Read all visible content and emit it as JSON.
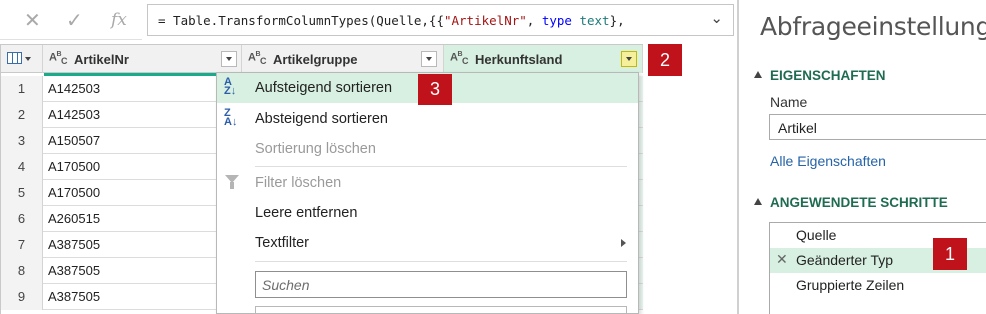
{
  "formula_bar": {
    "cancel_icon": "✕",
    "confirm_icon": "✓",
    "fx_label": "fx",
    "formula_plain": "= Table.TransformColumnTypes(Quelle,{{",
    "formula_str": "\"ArtikelNr\"",
    "formula_sep": ", ",
    "formula_kw": "type",
    "formula_type": " text",
    "formula_end": "},",
    "expand_icon": "chevron-down-icon"
  },
  "grid": {
    "columns": [
      {
        "type_icon": "ABC",
        "name": "ArtikelNr"
      },
      {
        "type_icon": "ABC",
        "name": "Artikelgruppe"
      },
      {
        "type_icon": "ABC",
        "name": "Herkunftsland"
      }
    ],
    "rows": [
      {
        "num": "1",
        "artikelnr": "A142503"
      },
      {
        "num": "2",
        "artikelnr": "A142503"
      },
      {
        "num": "3",
        "artikelnr": "A150507"
      },
      {
        "num": "4",
        "artikelnr": "A170500"
      },
      {
        "num": "5",
        "artikelnr": "A170500"
      },
      {
        "num": "6",
        "artikelnr": "A260515"
      },
      {
        "num": "7",
        "artikelnr": "A387505"
      },
      {
        "num": "8",
        "artikelnr": "A387505"
      },
      {
        "num": "9",
        "artikelnr": "A387505"
      }
    ]
  },
  "menu": {
    "items": [
      {
        "label": "Aufsteigend sortieren",
        "icon": "sort-ascending-icon"
      },
      {
        "label": "Absteigend sortieren",
        "icon": "sort-descending-icon"
      },
      {
        "label": "Sortierung löschen"
      },
      {
        "label": "Filter löschen",
        "icon": "filter-clear-icon"
      },
      {
        "label": "Leere entfernen"
      },
      {
        "label": "Textfilter"
      }
    ],
    "search_placeholder": "Suchen"
  },
  "badges": {
    "b1": "1",
    "b2": "2",
    "b3": "3"
  },
  "pane": {
    "title": "Abfrageeinstellungen",
    "properties_title": "EIGENSCHAFTEN",
    "name_label": "Name",
    "name_value": "Artikel",
    "all_props_link": "Alle Eigenschaften",
    "steps_title": "ANGEWENDETE SCHRITTE",
    "steps": [
      "Quelle",
      "Geänderter Typ",
      "Gruppierte Zeilen"
    ],
    "delete_step_icon": "✕"
  },
  "colors": {
    "accent_green": "#1aab8a",
    "badge_red": "#c0121b",
    "highlight": "#d7f0e1",
    "section_green": "#1e6b52"
  }
}
